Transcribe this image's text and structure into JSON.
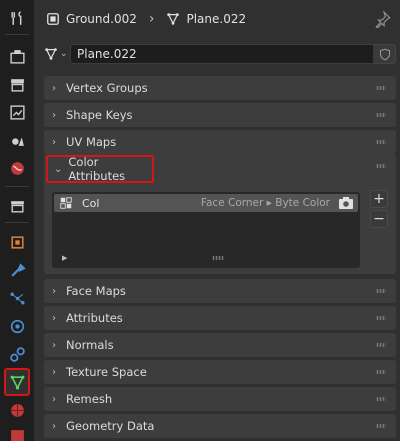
{
  "header": {
    "object_name": "Ground.002",
    "mesh_name": "Plane.022"
  },
  "mesh_selector": {
    "value": "Plane.022"
  },
  "panels_top": [
    {
      "label": "Vertex Groups"
    },
    {
      "label": "Shape Keys"
    },
    {
      "label": "UV Maps"
    }
  ],
  "color_attributes": {
    "label": "Color Attributes",
    "items": [
      {
        "name": "Col",
        "domain": "Face Corner ▸ Byte Color"
      }
    ],
    "add_label": "+",
    "remove_label": "−"
  },
  "panels_bottom": [
    {
      "label": "Face Maps"
    },
    {
      "label": "Attributes"
    },
    {
      "label": "Normals"
    },
    {
      "label": "Texture Space"
    },
    {
      "label": "Remesh"
    },
    {
      "label": "Geometry Data"
    }
  ],
  "colors": {
    "accent": "#d31717",
    "green_active": "#5fd35f"
  },
  "toolbar_icons": [
    "tool-icon",
    "render-icon",
    "output-icon",
    "view-layer-icon",
    "scene-icon",
    "world-icon",
    "collection-icon",
    "object-icon",
    "modifier-icon",
    "particles-icon",
    "physics-icon",
    "constraints-icon",
    "data-icon",
    "material-icon",
    "texture-icon"
  ]
}
